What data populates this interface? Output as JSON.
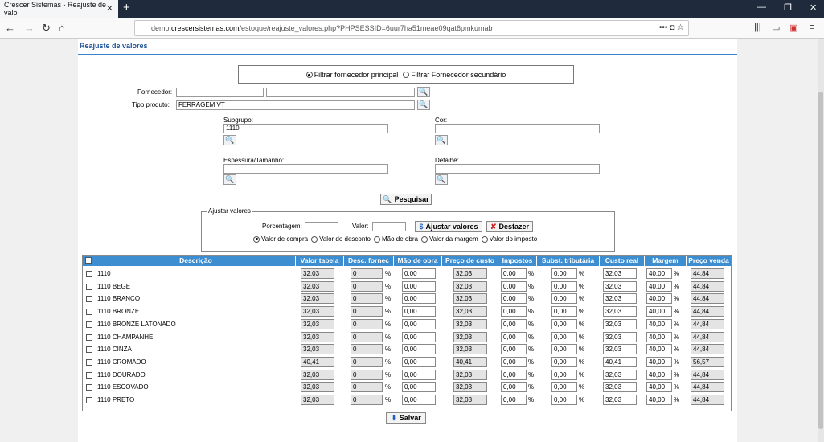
{
  "browser": {
    "tab_title": "Crescer Sistemas - Reajuste de valo",
    "url_prefix": "demo.",
    "url_domain": "crescersistemas.com",
    "url_path": "/estoque/reajuste_valores.php?PHPSESSID=6uur7ha51meae09qat6pmkumab"
  },
  "page": {
    "title": "Reajuste de valores",
    "filter_principal": "Filtrar fornecedor principal",
    "filter_secundario": "Filtrar Fornecedor secundário",
    "fornecedor_label": "Fornecedor:",
    "fornecedor_code": "",
    "fornecedor_name": "",
    "tipo_label": "Tipo produto:",
    "tipo_value": "FERRAGEM VT",
    "subgrupo_label": "Subgrupo:",
    "subgrupo_value": "1110",
    "cor_label": "Cor:",
    "cor_value": "",
    "espessura_label": "Espessura/Tamanho:",
    "espessura_value": "",
    "detalhe_label": "Detalhe:",
    "detalhe_value": "",
    "pesquisar": "Pesquisar"
  },
  "ajustar": {
    "legend": "Ajustar valores",
    "porcentagem_label": "Porcentagem:",
    "porcentagem_value": "",
    "valor_label": "Valor:",
    "valor_value": "",
    "ajustar_btn": "Ajustar valores",
    "desfazer_btn": "Desfazer",
    "opt_compra": "Valor de compra",
    "opt_desconto": "Valor do desconto",
    "opt_obra": "Mão de obra",
    "opt_margem": "Valor da margem",
    "opt_imposto": "Valor do imposto"
  },
  "table": {
    "headers": [
      "Descrição",
      "Valor tabela",
      "Desc. fornec",
      "Mão de obra",
      "Preço de custo",
      "Impostos",
      "Subst. tributária",
      "Custo real",
      "Margem",
      "Preço venda"
    ],
    "pct": "%",
    "rows": [
      {
        "desc": "1110",
        "vt": "32,03",
        "df": "0",
        "mo": "0,00",
        "pc": "32,03",
        "imp": "0,00",
        "st": "0,00",
        "cr": "32,03",
        "mg": "40,00",
        "pv": "44,84"
      },
      {
        "desc": "1110 BEGE",
        "vt": "32,03",
        "df": "0",
        "mo": "0,00",
        "pc": "32,03",
        "imp": "0,00",
        "st": "0,00",
        "cr": "32,03",
        "mg": "40,00",
        "pv": "44,84"
      },
      {
        "desc": "1110 BRANCO",
        "vt": "32,03",
        "df": "0",
        "mo": "0,00",
        "pc": "32,03",
        "imp": "0,00",
        "st": "0,00",
        "cr": "32,03",
        "mg": "40,00",
        "pv": "44,84"
      },
      {
        "desc": "1110 BRONZE",
        "vt": "32,03",
        "df": "0",
        "mo": "0,00",
        "pc": "32,03",
        "imp": "0,00",
        "st": "0,00",
        "cr": "32,03",
        "mg": "40,00",
        "pv": "44,84"
      },
      {
        "desc": "1110 BRONZE LATONADO",
        "vt": "32,03",
        "df": "0",
        "mo": "0,00",
        "pc": "32,03",
        "imp": "0,00",
        "st": "0,00",
        "cr": "32,03",
        "mg": "40,00",
        "pv": "44,84"
      },
      {
        "desc": "1110 CHAMPANHE",
        "vt": "32,03",
        "df": "0",
        "mo": "0,00",
        "pc": "32,03",
        "imp": "0,00",
        "st": "0,00",
        "cr": "32,03",
        "mg": "40,00",
        "pv": "44,84"
      },
      {
        "desc": "1110 CINZA",
        "vt": "32,03",
        "df": "0",
        "mo": "0,00",
        "pc": "32,03",
        "imp": "0,00",
        "st": "0,00",
        "cr": "32,03",
        "mg": "40,00",
        "pv": "44,84"
      },
      {
        "desc": "1110 CROMADO",
        "vt": "40,41",
        "df": "0",
        "mo": "0,00",
        "pc": "40,41",
        "imp": "0,00",
        "st": "0,00",
        "cr": "40,41",
        "mg": "40,00",
        "pv": "56,57"
      },
      {
        "desc": "1110 DOURADO",
        "vt": "32,03",
        "df": "0",
        "mo": "0,00",
        "pc": "32,03",
        "imp": "0,00",
        "st": "0,00",
        "cr": "32,03",
        "mg": "40,00",
        "pv": "44,84"
      },
      {
        "desc": "1110 ESCOVADO",
        "vt": "32,03",
        "df": "0",
        "mo": "0,00",
        "pc": "32,03",
        "imp": "0,00",
        "st": "0,00",
        "cr": "32,03",
        "mg": "40,00",
        "pv": "44,84"
      },
      {
        "desc": "1110 PRETO",
        "vt": "32,03",
        "df": "0",
        "mo": "0,00",
        "pc": "32,03",
        "imp": "0,00",
        "st": "0,00",
        "cr": "32,03",
        "mg": "40,00",
        "pv": "44,84"
      }
    ]
  },
  "salvar": "Salvar"
}
